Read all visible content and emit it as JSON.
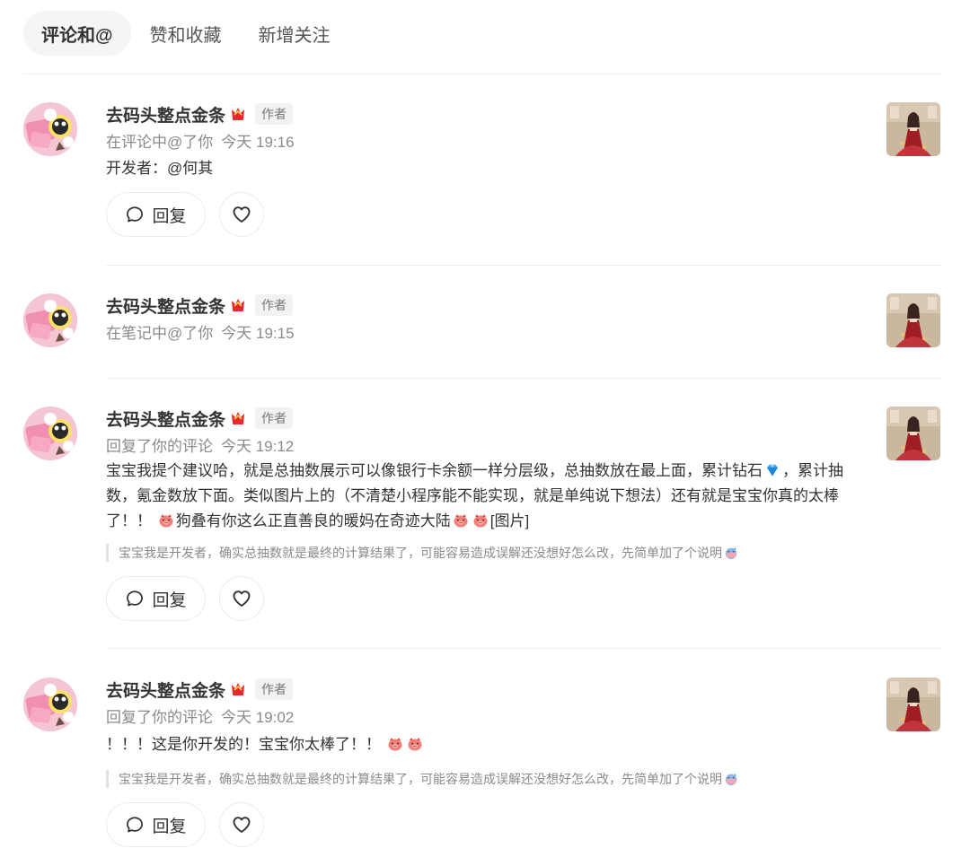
{
  "tabs": [
    {
      "label": "评论和@",
      "active": true
    },
    {
      "label": "赞和收藏",
      "active": false
    },
    {
      "label": "新增关注",
      "active": false
    }
  ],
  "colors": {
    "text": "#333333",
    "muted": "#8a8a8a",
    "divider": "#ededed",
    "crown": "#e8272f"
  },
  "actions": {
    "reply_label": "回复",
    "reply_icon": "comment-bubble-icon",
    "like_icon": "heart-outline-icon"
  },
  "notifications": [
    {
      "user": "去码头整点金条",
      "badge": "作者",
      "action": "在评论中@了你",
      "time": "今天 19:16",
      "content": "开发者：@何其",
      "quote": "",
      "has_actions": true
    },
    {
      "user": "去码头整点金条",
      "badge": "作者",
      "action": "在笔记中@了你",
      "time": "今天 19:15",
      "content": "",
      "quote": "",
      "has_actions": false
    },
    {
      "user": "去码头整点金条",
      "badge": "作者",
      "action": "回复了你的评论",
      "time": "今天 19:12",
      "content_parts": [
        "宝宝我提个建议哈，就是总抽数展示可以像银行卡余额一样分层级，总抽数放在最上面，累计钻石",
        "，累计抽数，氪金数放下面。类似图片上的（不清楚小程序能不能实现，就是单纯说下想法）还有就是宝宝你真的太棒了！！",
        "狗叠有你这么正直善良的暖妈在奇迹大陆",
        "[图片]"
      ],
      "quote": "宝宝我是开发者，确实总抽数就是最终的计算结果了，可能容易造成误解还没想好怎么改，先简单加了个说明",
      "has_actions": true
    },
    {
      "user": "去码头整点金条",
      "badge": "作者",
      "action": "回复了你的评论",
      "time": "今天 19:02",
      "content": "！！！这是你开发的！宝宝你太棒了！！",
      "quote": "宝宝我是开发者，确实总抽数就是最终的计算结果了，可能容易造成误解还没想好怎么改，先简单加了个说明",
      "has_actions": true
    }
  ]
}
